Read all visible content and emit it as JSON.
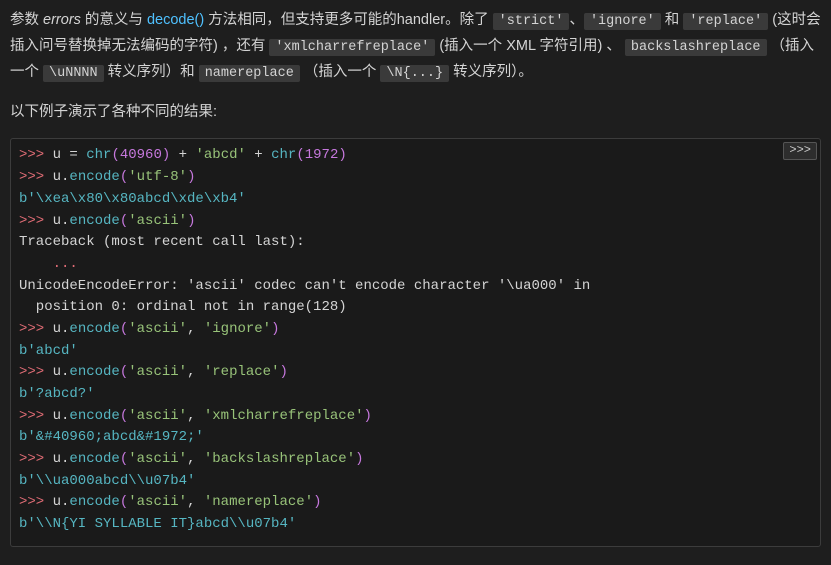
{
  "para1": {
    "t1": "参数 ",
    "em": "errors",
    "t2": " 的意义与 ",
    "link": "decode()",
    "t3": " 方法相同，但支持更多可能的handler。除了 ",
    "c1": "'strict'",
    "t4": "、",
    "c2": "'ignore'",
    "t5": " 和 ",
    "c3": "'replace'",
    "t6": "  (这时会插入问号替换掉无法编码的字符) ，还有 ",
    "c4": "'xmlcharrefreplace'",
    "t7": "  (插入一个 XML 字符引用) 、 ",
    "c5": "backslashreplace",
    "t8": " （插入一个 ",
    "c6": "\\uNNNN",
    "t9": " 转义序列）和 ",
    "c7": "namereplace",
    "t10": " （插入一个 ",
    "c8": "\\N{...}",
    "t11": " 转义序列）。"
  },
  "para2": "以下例子演示了各种不同的结果:",
  "copy_label": ">>>",
  "code": {
    "p": ">>> ",
    "l1": {
      "a": "u ",
      "b": "=",
      "c": " chr",
      "d": "(",
      "e": "40960",
      "f": ")",
      "g": " + ",
      "h": "'abcd'",
      "i": " + ",
      "j": "chr",
      "k": "(",
      "l": "1972",
      "m": ")"
    },
    "l2": {
      "a": "u",
      "b": ".",
      "c": "encode",
      "d": "(",
      "e": "'utf-8'",
      "f": ")"
    },
    "o1": "b'\\xea\\x80\\x80abcd\\xde\\xb4'",
    "l3": {
      "a": "u",
      "b": ".",
      "c": "encode",
      "d": "(",
      "e": "'ascii'",
      "f": ")"
    },
    "e1": "Traceback (most recent call last):",
    "e2": "    ...",
    "e3": "UnicodeEncodeError: 'ascii' codec can't encode character '\\ua000' in",
    "e4": "  position 0: ordinal not in range(128)",
    "l4": {
      "a": "u",
      "b": ".",
      "c": "encode",
      "d": "(",
      "e": "'ascii'",
      "f": ", ",
      "g": "'ignore'",
      "h": ")"
    },
    "o2": "b'abcd'",
    "l5": {
      "a": "u",
      "b": ".",
      "c": "encode",
      "d": "(",
      "e": "'ascii'",
      "f": ", ",
      "g": "'replace'",
      "h": ")"
    },
    "o3": "b'?abcd?'",
    "l6": {
      "a": "u",
      "b": ".",
      "c": "encode",
      "d": "(",
      "e": "'ascii'",
      "f": ", ",
      "g": "'xmlcharrefreplace'",
      "h": ")"
    },
    "o4": "b'&#40960;abcd&#1972;'",
    "l7": {
      "a": "u",
      "b": ".",
      "c": "encode",
      "d": "(",
      "e": "'ascii'",
      "f": ", ",
      "g": "'backslashreplace'",
      "h": ")"
    },
    "o5": "b'\\\\ua000abcd\\\\u07b4'",
    "l8": {
      "a": "u",
      "b": ".",
      "c": "encode",
      "d": "(",
      "e": "'ascii'",
      "f": ", ",
      "g": "'namereplace'",
      "h": ")"
    },
    "o6": "b'\\\\N{YI SYLLABLE IT}abcd\\\\u07b4'"
  }
}
